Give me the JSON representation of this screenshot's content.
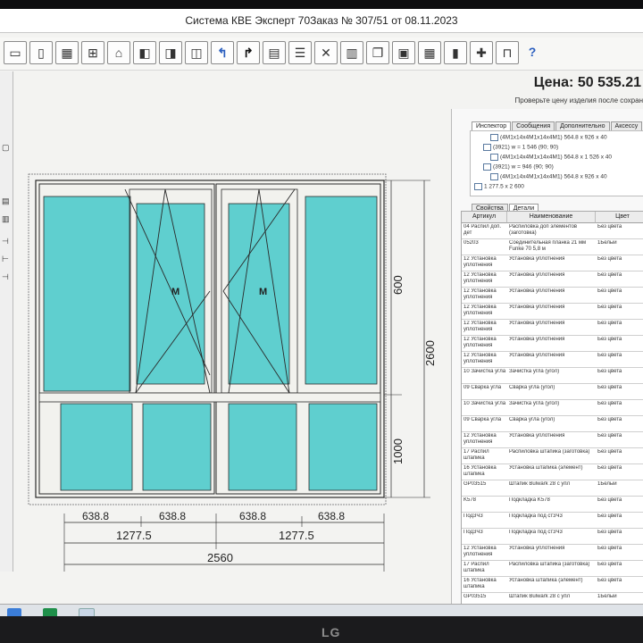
{
  "window": {
    "title": "Система КВЕ Эксперт 70Заказ № 307/51 от 08.11.2023"
  },
  "toolbar": {
    "buttons": [
      {
        "name": "frame-one-icon",
        "glyph": "▭"
      },
      {
        "name": "frame-two-icon",
        "glyph": "▯"
      },
      {
        "name": "frame-grid-icon",
        "glyph": "▦"
      },
      {
        "name": "frame-cross-icon",
        "glyph": "⊞"
      },
      {
        "name": "frame-arch-icon",
        "glyph": "⌂"
      },
      {
        "name": "sash-left-icon",
        "glyph": "◧"
      },
      {
        "name": "sash-right-icon",
        "glyph": "◨"
      },
      {
        "name": "sash-double-icon",
        "glyph": "◫"
      },
      {
        "name": "undo-arrow-icon",
        "glyph": "↰"
      },
      {
        "name": "redo-arrow-icon",
        "glyph": "↱"
      },
      {
        "name": "table-icon",
        "glyph": "▤"
      },
      {
        "name": "list-icon",
        "glyph": "☰"
      },
      {
        "name": "delete-icon",
        "glyph": "✕"
      },
      {
        "name": "catalog-icon",
        "glyph": "▥"
      },
      {
        "name": "copy-icon",
        "glyph": "❐"
      },
      {
        "name": "report-icon",
        "glyph": "▣"
      },
      {
        "name": "calculator-icon",
        "glyph": "▦"
      },
      {
        "name": "accessory-icon",
        "glyph": "▮"
      },
      {
        "name": "mosquito-icon",
        "glyph": "✚"
      },
      {
        "name": "sill-icon",
        "glyph": "⊓"
      },
      {
        "name": "help-icon",
        "glyph": "?"
      }
    ]
  },
  "price": {
    "text": "Цена: 50 535.21"
  },
  "hint": {
    "text": "Проверьте цену изделия после сохран"
  },
  "inspector": {
    "tabs": [
      "Инспектор",
      "Сообщения",
      "Дополнительно",
      "Аксессу"
    ],
    "tree": [
      "(4M1x14x4M1x14x4M1) 564.8 x 926 x 40",
      "(3921) w = 1 546 (90; 90)",
      "(4M1x14x4M1x14x4M1) 564.8 x 1 526 x 40",
      "(3921) w = 946 (90; 90)",
      "(4M1x14x4M1x14x4M1) 564.8 x 926 x 40",
      "1 277.5 x 2 600"
    ]
  },
  "details": {
    "tabs": [
      "Свойства",
      "Детали"
    ],
    "columns": [
      "Артикул",
      "Наименование",
      "Цвет"
    ],
    "rows": [
      [
        "04 Распил доп. дет",
        "Распиловка доп элементов (заготовка)",
        "Без цвета"
      ],
      [
        "05203",
        "Соединительная планка 21 мм Funke 70 5,8 м",
        "1Белый"
      ],
      [
        "12 Установка уплотнения",
        "Установка уплотнения",
        "Без цвета"
      ],
      [
        "12 Установка уплотнения",
        "Установка уплотнения",
        "Без цвета"
      ],
      [
        "12 Установка уплотнения",
        "Установка уплотнения",
        "Без цвета"
      ],
      [
        "12 Установка уплотнения",
        "Установка уплотнения",
        "Без цвета"
      ],
      [
        "12 Установка уплотнения",
        "Установка уплотнения",
        "Без цвета"
      ],
      [
        "12 Установка уплотнения",
        "Установка уплотнения",
        "Без цвета"
      ],
      [
        "12 Установка уплотнения",
        "Установка уплотнения",
        "Без цвета"
      ],
      [
        "10 Зачистка угла",
        "Зачистка угла (угол)",
        "Без цвета"
      ],
      [
        "09 Сварка угла",
        "Сварка угла (угол)",
        "Без цвета"
      ],
      [
        "10 Зачистка угла",
        "Зачистка угла (угол)",
        "Без цвета"
      ],
      [
        "09 Сварка угла",
        "Сварка угла (угол)",
        "Без цвета"
      ],
      [
        "12 Установка уплотнения",
        "Установка уплотнения",
        "Без цвета"
      ],
      [
        "17 Распил штапика",
        "Распиловка штапика (заготовка)",
        "Без цвета"
      ],
      [
        "16 Установка штапика",
        "Установка штапика (элемент)",
        "Без цвета"
      ],
      [
        "GP03515",
        "Штапик Bulwark 28 с упл",
        "1Белый"
      ],
      [
        "K578",
        "Подкладка K578",
        "Без цвета"
      ],
      [
        "Под3Ч3",
        "Подкладка под ст3Ч3",
        "Без цвета"
      ],
      [
        "Под3Ч3",
        "Подкладка под ст3Ч3",
        "Без цвета"
      ],
      [
        "12 Установка уплотнения",
        "Установка уплотнения",
        "Без цвета"
      ],
      [
        "17 Распил штапика",
        "Распиловка штапика (заготовка)",
        "Без цвета"
      ],
      [
        "16 Установка штапика",
        "Установка штапика (элемент)",
        "Без цвета"
      ],
      [
        "GP03515",
        "Штапик Bulwark 28 с упл",
        "1Белый"
      ]
    ]
  },
  "drawing": {
    "sash_labels": [
      "M",
      "M"
    ],
    "dim_right_top": "600",
    "dim_right_total": "2600",
    "dim_right_bottom": "1000",
    "dim_bottom_parts": [
      "638.8",
      "638.8",
      "638.8",
      "638.8"
    ],
    "dim_bottom_halves": [
      "1277.5",
      "1277.5"
    ],
    "dim_bottom_total": "2560",
    "glass_color": "#5fcfcf",
    "frame_color": "#f2f2ee",
    "line_color": "#2a2a2a"
  },
  "bezel": {
    "logo": "LG"
  }
}
